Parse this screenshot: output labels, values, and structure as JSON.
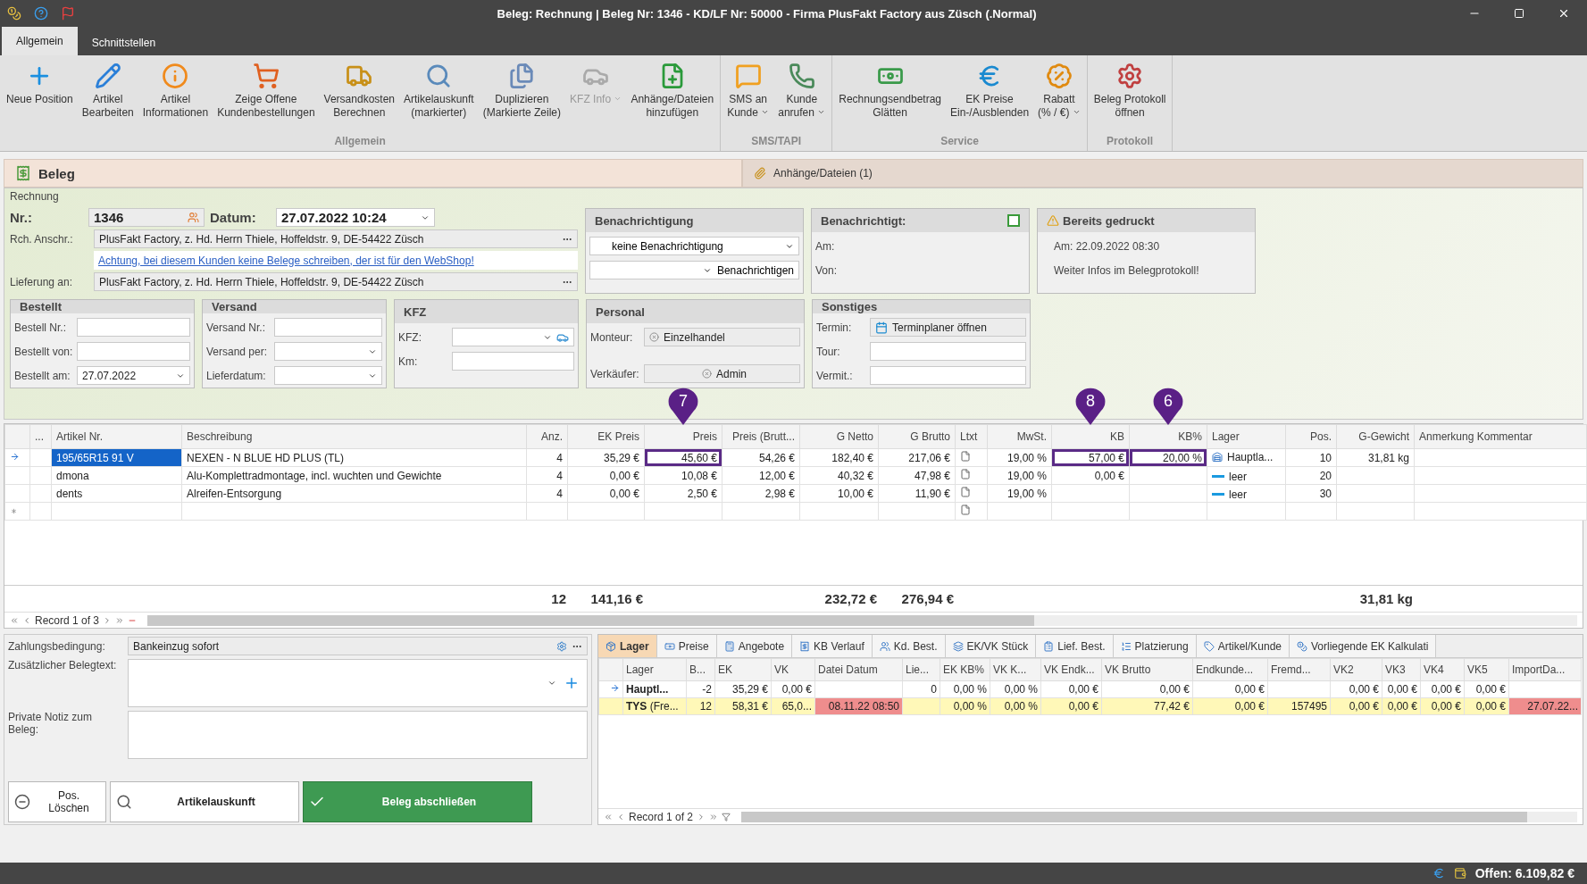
{
  "window": {
    "title": "Beleg: Rechnung | Beleg Nr: 1346 -  KD/LF Nr: 50000 - Firma PlusFakt Factory  aus Züsch (.Normal)"
  },
  "ribbon": {
    "tabs": [
      {
        "label": "Allgemein",
        "selected": true
      },
      {
        "label": "Schnittstellen",
        "selected": false
      }
    ],
    "groups": [
      {
        "label": "Allgemein",
        "items": [
          {
            "lines": [
              "Neue Position"
            ],
            "dropdown": false,
            "disabled": false
          },
          {
            "lines": [
              "Artikel",
              "Bearbeiten"
            ],
            "dropdown": false,
            "disabled": false
          },
          {
            "lines": [
              "Artikel",
              "Informationen"
            ],
            "dropdown": false,
            "disabled": false
          },
          {
            "lines": [
              "Zeige Offene",
              "Kundenbestellungen"
            ],
            "dropdown": false,
            "disabled": false
          },
          {
            "lines": [
              "Versandkosten",
              "Berechnen"
            ],
            "dropdown": false,
            "disabled": false
          },
          {
            "lines": [
              "Artikelauskunft",
              "(markierter)"
            ],
            "dropdown": false,
            "disabled": false
          },
          {
            "lines": [
              "Duplizieren",
              "(Markierte Zeile)"
            ],
            "dropdown": false,
            "disabled": false
          },
          {
            "lines": [
              "KFZ Info"
            ],
            "dropdown": true,
            "disabled": true
          },
          {
            "lines": [
              "Anhänge/Dateien",
              "hinzufügen"
            ],
            "dropdown": false,
            "disabled": false
          }
        ]
      },
      {
        "label": "SMS/TAPI",
        "items": [
          {
            "lines": [
              "SMS an",
              "Kunde"
            ],
            "dropdown": true,
            "disabled": false
          },
          {
            "lines": [
              "Kunde",
              "anrufen"
            ],
            "dropdown": true,
            "disabled": false
          }
        ]
      },
      {
        "label": "Service",
        "items": [
          {
            "lines": [
              "Rechnungsendbetrag",
              "Glätten"
            ],
            "dropdown": false,
            "disabled": false
          },
          {
            "lines": [
              "EK Preise",
              "Ein-/Ausblenden"
            ],
            "dropdown": false,
            "disabled": false
          },
          {
            "lines": [
              "Rabatt",
              "(% / €)"
            ],
            "dropdown": true,
            "disabled": false
          }
        ]
      },
      {
        "label": "Protokoll",
        "items": [
          {
            "lines": [
              "Beleg Protokoll",
              "öffnen"
            ],
            "dropdown": false,
            "disabled": false
          }
        ]
      }
    ]
  },
  "doc_tabs": [
    {
      "label": "Beleg",
      "selected": true
    },
    {
      "label": "Anhänge/Dateien (1)",
      "selected": false
    }
  ],
  "form": {
    "legend": "Rechnung",
    "nr": {
      "label": "Nr.:",
      "value": "1346"
    },
    "datum": {
      "label": "Datum:",
      "value": "27.07.2022 10:24"
    },
    "rch_anschr": {
      "label": "Rch. Anschr.:",
      "value": "PlusFakt Factory, z. Hd. Herrn Thiele, Hoffeldstr. 9,  DE-54422 Züsch"
    },
    "warning_link": "Achtung, bei diesem Kunden keine Belege schreiben, der ist für den WebShop!",
    "lieferung": {
      "label": "Lieferung an:",
      "value": "PlusFakt Factory, z. Hd. Herrn Thiele, Hoffeldstr. 9,  DE-54422 Züsch"
    }
  },
  "benachrichtigung": {
    "title": "Benachrichtigung",
    "select": "keine Benachrichtigung",
    "button": "Benachrichtigen"
  },
  "benachrichtigt": {
    "title": "Benachrichtigt:",
    "checked": false,
    "rows": [
      "Am:",
      "Von:"
    ]
  },
  "gedruckt": {
    "title": "Bereits gedruckt",
    "lines": [
      "Am:  22.09.2022 08:30",
      "Weiter Infos im Belegprotokoll!"
    ]
  },
  "panels": [
    {
      "title": "Bestellt",
      "fields": [
        {
          "label": "Bestell Nr.:",
          "kind": "text"
        },
        {
          "label": "Bestellt von:",
          "kind": "text"
        },
        {
          "label": "Bestellt am:",
          "kind": "select",
          "value": "27.07.2022"
        }
      ]
    },
    {
      "title": "Versand",
      "fields": [
        {
          "label": "Versand Nr.:",
          "kind": "text"
        },
        {
          "label": "Versand per:",
          "kind": "select"
        },
        {
          "label": "Lieferdatum:",
          "kind": "select"
        }
      ]
    },
    {
      "title": "KFZ",
      "fields": [
        {
          "label": "KFZ:",
          "kind": "car-select"
        },
        {
          "label": "Km:",
          "kind": "text"
        }
      ]
    },
    {
      "title": "Personal",
      "fields": [
        {
          "label": "Monteur:",
          "kind": "tag",
          "value": "Einzelhandel"
        },
        {
          "label": "Verkäufer:",
          "kind": "tag",
          "value": "Admin"
        }
      ]
    },
    {
      "title": "Sonstiges",
      "fields": [
        {
          "label": "Termin:",
          "kind": "button",
          "value": "Terminplaner öffnen"
        },
        {
          "label": "Tour:",
          "kind": "text"
        },
        {
          "label": "Vermit.:",
          "kind": "text"
        }
      ]
    }
  ],
  "grid": {
    "columns": [
      {
        "label": "...",
        "kind": "text"
      },
      {
        "label": "Artikel Nr.",
        "kind": "text"
      },
      {
        "label": "Beschreibung",
        "kind": "text"
      },
      {
        "label": "Anz.",
        "kind": "number",
        "total": "12"
      },
      {
        "label": "EK Preis",
        "kind": "number",
        "total": "141,16 €"
      },
      {
        "label": "Preis",
        "kind": "number",
        "callout": "7"
      },
      {
        "label": "Preis (Brutt...",
        "kind": "number"
      },
      {
        "label": "G Netto",
        "kind": "number",
        "total": "232,72 €"
      },
      {
        "label": "G Brutto",
        "kind": "number",
        "total": "276,94 €"
      },
      {
        "label": "Ltxt",
        "kind": "note"
      },
      {
        "label": "MwSt.",
        "kind": "number"
      },
      {
        "label": "KB",
        "kind": "number",
        "callout": "8"
      },
      {
        "label": "KB%",
        "kind": "number",
        "callout": "6"
      },
      {
        "label": "Lager",
        "kind": "stock"
      },
      {
        "label": "Pos.",
        "kind": "number"
      },
      {
        "label": "G-Gewicht",
        "kind": "number",
        "total": "31,81 kg"
      },
      {
        "label": "Anmerkung Kommentar",
        "kind": "text"
      }
    ],
    "rows": [
      {
        "kind": "current",
        "cells": [
          null,
          {
            "text": "195/65R15 91 V",
            "selected": true
          },
          "NEXEN - N BLUE HD PLUS (TL)",
          "4",
          "35,29 €",
          {
            "text": "45,60 €",
            "outlined": true
          },
          "54,26 €",
          "182,40 €",
          "217,06 €",
          null,
          "19,00 %",
          {
            "text": "57,00 €",
            "outlined": true
          },
          {
            "text": "20,00 %",
            "outlined": true
          },
          {
            "text": "Hauptla...",
            "kind": "stocked"
          },
          "10",
          "31,81 kg",
          null
        ]
      },
      {
        "kind": "normal",
        "cells": [
          null,
          "dmona",
          "Alu-Komplettradmontage, incl. wuchten und Gewichte",
          "4",
          "0,00 €",
          "10,08 €",
          "12,00 €",
          "40,32 €",
          "47,98 €",
          null,
          "19,00 %",
          "0,00 €",
          null,
          {
            "text": "leer",
            "kind": "empty"
          },
          "20",
          null,
          null
        ]
      },
      {
        "kind": "normal",
        "cells": [
          null,
          "dents",
          "Alreifen-Entsorgung",
          "4",
          "0,00 €",
          "2,50 €",
          "2,98 €",
          "10,00 €",
          "11,90 €",
          null,
          "19,00 %",
          null,
          null,
          {
            "text": "leer",
            "kind": "empty"
          },
          "30",
          null,
          null
        ]
      },
      {
        "kind": "new",
        "cells": [
          null,
          null,
          null,
          null,
          null,
          null,
          null,
          null,
          null,
          null,
          null,
          null,
          null,
          null,
          null,
          null,
          null
        ]
      }
    ],
    "record": "Record 1 of 3"
  },
  "payment": {
    "label": "Zahlungsbedingung:",
    "value": "Bankeinzug sofort"
  },
  "extra_text": {
    "label": "Zusätzlicher Belegtext:"
  },
  "private_note": {
    "label": "Private Notiz zum Beleg:"
  },
  "actions": [
    {
      "label": "Pos. Löschen",
      "kind": "delete"
    },
    {
      "label": "Artikelauskunft",
      "kind": "lookup"
    },
    {
      "label": "Beleg abschließen",
      "kind": "primary"
    }
  ],
  "detail": {
    "tabs": [
      {
        "label": "Lager",
        "selected": true
      },
      {
        "label": "Preise",
        "selected": false
      },
      {
        "label": "Angebote",
        "selected": false
      },
      {
        "label": "KB Verlauf",
        "selected": false
      },
      {
        "label": "Kd. Best.",
        "selected": false
      },
      {
        "label": "EK/VK Stück",
        "selected": false
      },
      {
        "label": "Lief. Best.",
        "selected": false
      },
      {
        "label": "Platzierung",
        "selected": false
      },
      {
        "label": "Artikel/Kunde",
        "selected": false
      },
      {
        "label": "Vorliegende EK Kalkulati",
        "selected": false
      }
    ],
    "columns": [
      "Lager",
      "B...",
      "EK",
      "VK",
      "Datei Datum",
      "Lie...",
      "EK KB%",
      "VK K...",
      "VK Endk...",
      "VK Brutto",
      "Endkunde...",
      "Fremd...",
      "VK2",
      "VK3",
      "VK4",
      "VK5",
      "ImportDa..."
    ],
    "rows": [
      {
        "current": true,
        "highlighted": false,
        "cells": [
          {
            "text": "Hauptl..."
          },
          {
            "text": "-2"
          },
          {
            "text": "35,29 €"
          },
          {
            "text": "0,00 €"
          },
          null,
          {
            "text": "0"
          },
          {
            "text": "0,00 %"
          },
          {
            "text": "0,00 %"
          },
          {
            "text": "0,00 €"
          },
          {
            "text": "0,00 €"
          },
          {
            "text": "0,00 €"
          },
          null,
          {
            "text": "0,00 €"
          },
          {
            "text": "0,00 €"
          },
          {
            "text": "0,00 €"
          },
          {
            "text": "0,00 €"
          },
          null
        ]
      },
      {
        "current": false,
        "highlighted": true,
        "cells": [
          {
            "text": "**TYS** (Fre..."
          },
          {
            "text": "12"
          },
          {
            "text": "58,31 €"
          },
          {
            "text": "65,0..."
          },
          {
            "text": "08.11.22 08:50",
            "alert": true
          },
          null,
          {
            "text": "0,00 %"
          },
          {
            "text": "0,00 %"
          },
          {
            "text": "0,00 €"
          },
          {
            "text": "77,42 €"
          },
          {
            "text": "0,00 €"
          },
          {
            "text": "157495"
          },
          {
            "text": "0,00 €"
          },
          {
            "text": "0,00 €"
          },
          {
            "text": "0,00 €"
          },
          {
            "text": "0,00 €"
          },
          {
            "text": "27.07.22...",
            "alert": true
          }
        ]
      }
    ],
    "record": "Record 1 of 2"
  },
  "status_bar": {
    "open_amount": "Offen: 6.109,82 €"
  }
}
